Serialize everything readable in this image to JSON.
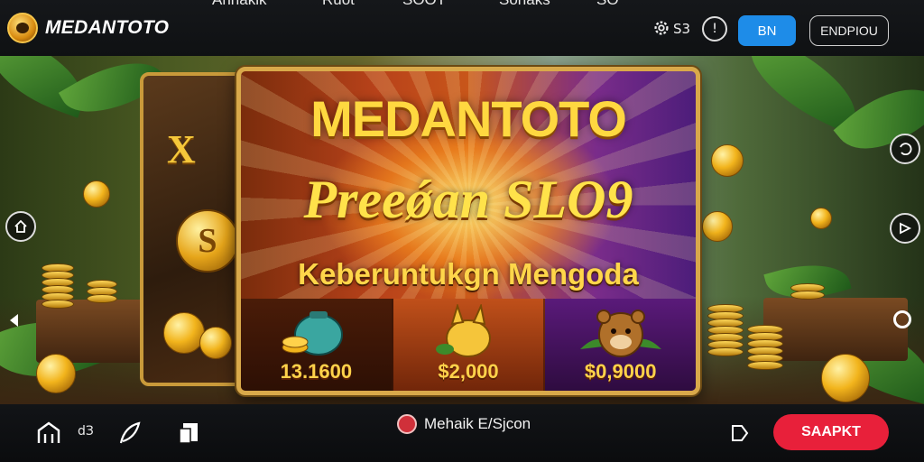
{
  "header": {
    "brand": "MEDANTOTO",
    "nav": [
      "Annakik",
      "Ruot",
      "SOOT",
      "Sonaks",
      "SO"
    ],
    "settings_label": "S3",
    "info_label": "!",
    "primary_button": "BN",
    "secondary_button": "ENDPIOU"
  },
  "banner": {
    "title": "MEDANTOTO",
    "subtitle": "Preeǿan SLO9",
    "tagline": "Keberuntukgn Mengoda",
    "prizes": [
      {
        "amount": "13.1600",
        "icon": "money-bag-icon"
      },
      {
        "amount": "$2,000",
        "icon": "golden-animal-icon"
      },
      {
        "amount": "$0,9000",
        "icon": "bear-icon"
      }
    ],
    "back_card_letter": "X",
    "back_card_coin": "S"
  },
  "side_controls": {
    "left": [
      "home-icon",
      "arrow-left-icon"
    ],
    "right": [
      "rotate-icon",
      "forward-icon",
      "circle-icon"
    ]
  },
  "footer": {
    "small_label": "dЗ",
    "status_text": "Mehaik E/Sjcon",
    "cta_button": "SAAPKT"
  },
  "colors": {
    "primary_blue": "#1e8ce8",
    "cta_red": "#e8203a",
    "gold": "#ffd840",
    "dark_bar": "#121417"
  }
}
